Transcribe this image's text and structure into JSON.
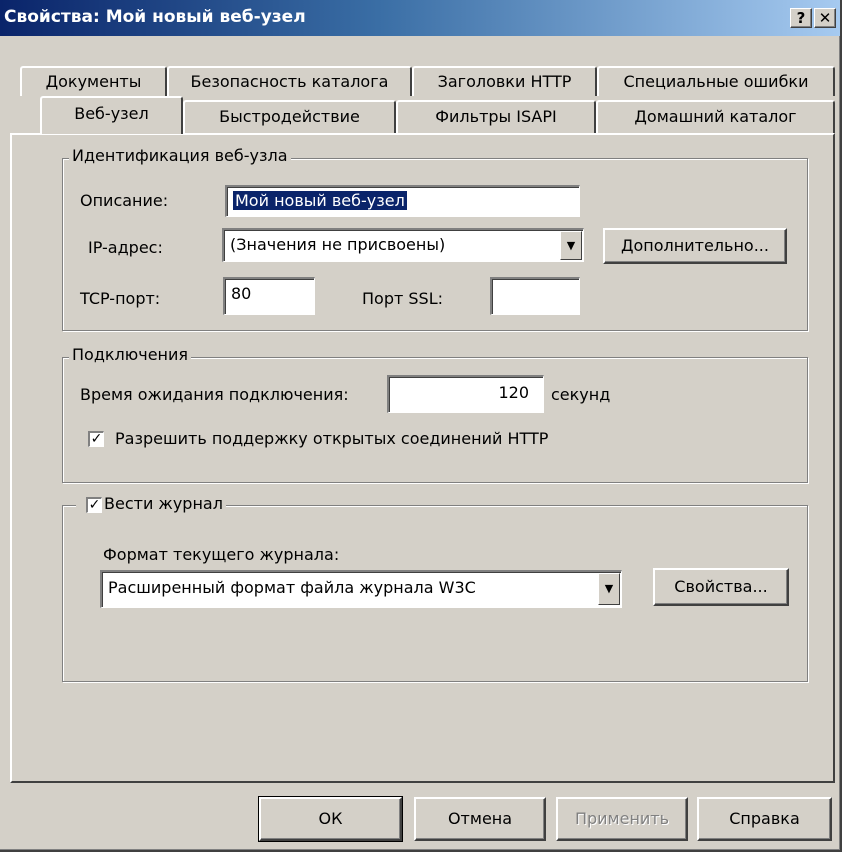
{
  "window": {
    "title": "Свойства: Мой новый веб-узел",
    "help_button": "?",
    "close_button": "✕"
  },
  "tabs_row1": [
    {
      "label": "Документы"
    },
    {
      "label": "Безопасность каталога"
    },
    {
      "label": "Заголовки HTTP"
    },
    {
      "label": "Специальные ошибки"
    }
  ],
  "tabs_row2": [
    {
      "label": "Веб-узел",
      "active": true
    },
    {
      "label": "Быстродействие"
    },
    {
      "label": "Фильтры ISAPI"
    },
    {
      "label": "Домашний каталог"
    }
  ],
  "identification": {
    "legend": "Идентификация веб-узла",
    "description_label": "Описание:",
    "description_value": "Мой новый веб-узел",
    "ip_label": "IP-адрес:",
    "ip_value": "(Значения не присвоены)",
    "advanced_button": "Дополнительно...",
    "tcp_label": "TCP-порт:",
    "tcp_value": "80",
    "ssl_label": "Порт SSL:",
    "ssl_value": ""
  },
  "connections": {
    "legend": "Подключения",
    "timeout_label": "Время ожидания подключения:",
    "timeout_value": "120",
    "timeout_unit": "секунд",
    "keepalive_label": "Разрешить поддержку открытых соединений HTTP",
    "keepalive_checked": true
  },
  "logging": {
    "legend": "Вести журнал",
    "enabled": true,
    "format_label": "Формат текущего журнала:",
    "format_value": "Расширенный формат файла журнала W3C",
    "properties_button": "Свойства..."
  },
  "buttons": {
    "ok": "ОК",
    "cancel": "Отмена",
    "apply": "Применить",
    "help": "Справка"
  }
}
